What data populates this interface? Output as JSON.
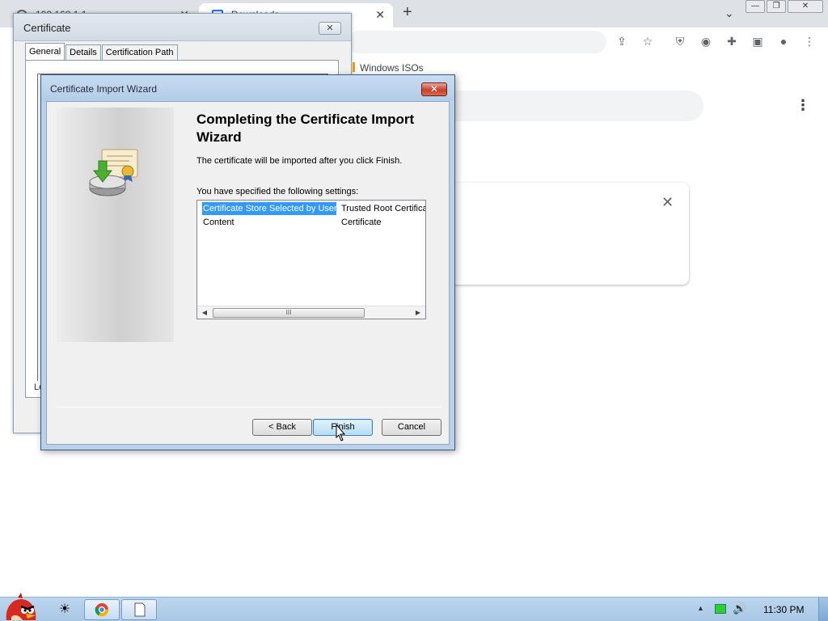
{
  "browser": {
    "tabs": [
      {
        "label": "192.168.1.1"
      },
      {
        "label": "Downloads"
      }
    ],
    "new_tab_label": "+",
    "bookmark": "Windows ISOs"
  },
  "certificate_dialog": {
    "title": "Certificate",
    "close_label": "✕",
    "tabs": [
      "General",
      "Details",
      "Certification Path"
    ],
    "learn_more_fragment": "Le"
  },
  "wizard": {
    "title": "Certificate Import Wizard",
    "close_label": "✕",
    "heading": "Completing the Certificate Import Wizard",
    "description": "The certificate will be imported after you click Finish.",
    "settings_label": "You have specified the following settings:",
    "settings": [
      {
        "name": "Certificate Store Selected by User",
        "value": "Trusted Root Certifica"
      },
      {
        "name": "Content",
        "value": "Certificate"
      }
    ],
    "scroll_thumb_label": "III",
    "buttons": {
      "back": "< Back",
      "finish": "Finish",
      "cancel": "Cancel"
    }
  },
  "taskbar": {
    "clock": "11:30 PM"
  },
  "colors": {
    "selection": "#3399ff",
    "wizard_frame": "#b9d1ea",
    "taskbar": "#bcd6ee",
    "close_red": "#c7402b"
  }
}
